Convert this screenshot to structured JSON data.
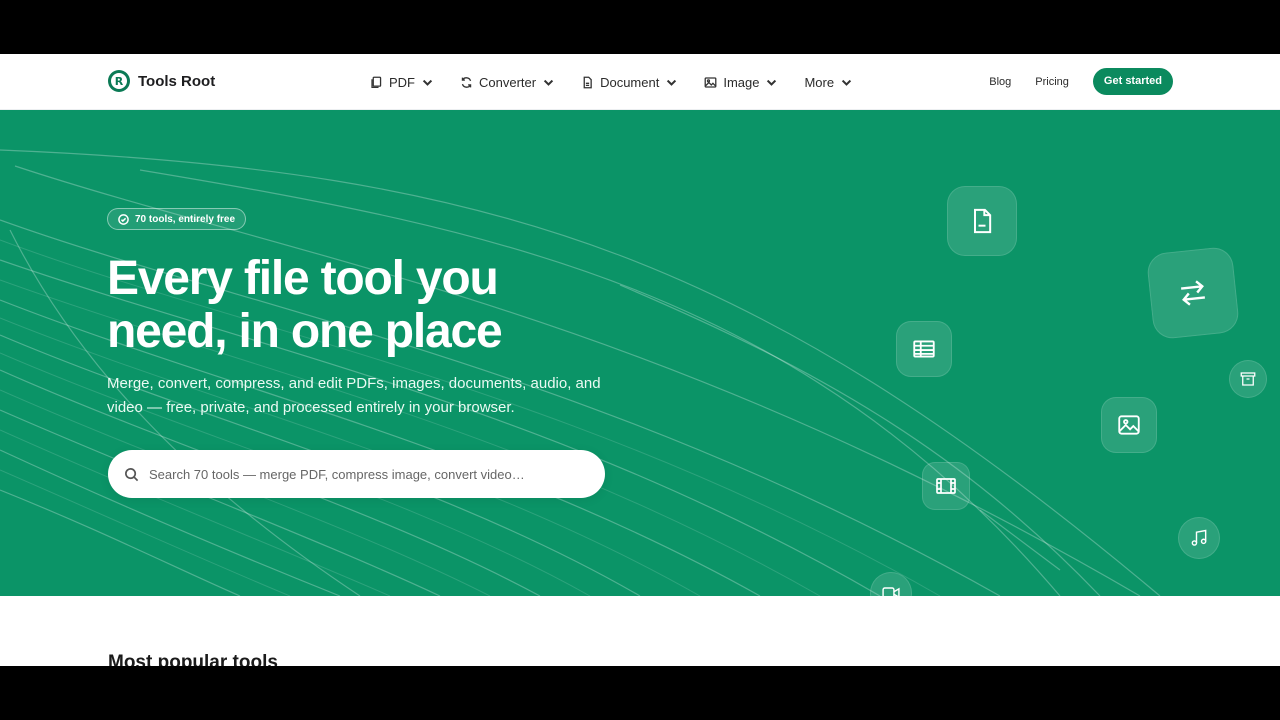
{
  "brand": {
    "name": "Tools Root",
    "mark": "R",
    "accent": "#0b8a5e",
    "hero_bg": "#0b9467"
  },
  "nav": {
    "items": [
      {
        "label": "PDF",
        "icon": "files-icon"
      },
      {
        "label": "Converter",
        "icon": "refresh-icon"
      },
      {
        "label": "Document",
        "icon": "document-icon"
      },
      {
        "label": "Image",
        "icon": "image-icon"
      },
      {
        "label": "More",
        "icon": ""
      }
    ],
    "blog": "Blog",
    "pricing": "Pricing",
    "cta": "Get started"
  },
  "hero": {
    "badge": "70 tools, entirely free",
    "title_line1": "Every file tool you",
    "title_line2": "need, in one place",
    "subtitle": "Merge, convert, compress, and edit PDFs, images, documents, audio, and video — free, private, and processed entirely in your browser.",
    "search_placeholder": "Search 70 tools — merge PDF, compress image, convert video…",
    "floating_icons": [
      "document-icon",
      "swap-arrows-icon",
      "spreadsheet-icon",
      "archive-icon",
      "image-icon",
      "film-icon",
      "music-icon",
      "video-camera-icon",
      "speaker-icon"
    ]
  },
  "popular": {
    "title": "Most popular tools"
  }
}
